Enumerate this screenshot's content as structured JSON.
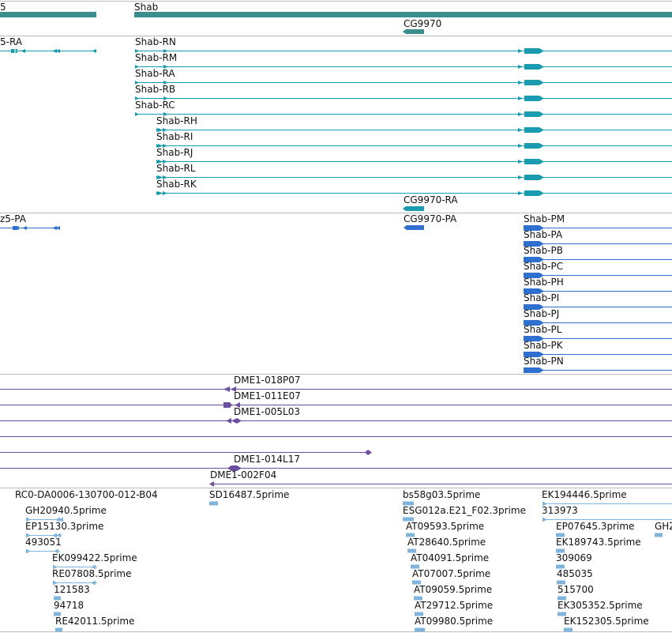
{
  "colors": {
    "gene": "#3c8d8d",
    "transcript": "#1a9cb0",
    "protein": "#2f6fd0",
    "clone": "#6a4fa0",
    "est": "#7fb5dc",
    "separator": "#bbbbbb"
  },
  "tracks": {
    "genes": {
      "items": [
        {
          "label": "5",
          "name": "gene-fragment-left"
        },
        {
          "label": "Shab",
          "name": "gene-shab"
        },
        {
          "label": "CG9970",
          "name": "gene-cg9970"
        }
      ]
    },
    "transcripts": {
      "left_label": "5-RA",
      "cg9970_label": "CG9970-RA",
      "shab_labels": [
        "Shab-RN",
        "Shab-RM",
        "Shab-RA",
        "Shab-RB",
        "Shab-RC",
        "Shab-RH",
        "Shab-RI",
        "Shab-RJ",
        "Shab-RL",
        "Shab-RK"
      ]
    },
    "proteins": {
      "left_label": "z5-PA",
      "cg9970_label": "CG9970-PA",
      "shab_labels": [
        "Shab-PM",
        "Shab-PA",
        "Shab-PB",
        "Shab-PC",
        "Shab-PH",
        "Shab-PI",
        "Shab-PJ",
        "Shab-PL",
        "Shab-PK",
        "Shab-PN"
      ]
    },
    "clones": {
      "labels": [
        "DME1-018P07",
        "DME1-011E07",
        "DME1-005L03",
        "DME1-014L17",
        "DME1-002F04"
      ]
    },
    "ests": {
      "col1": [
        "RC0-DA0006-130700-012-B04",
        "GH20940.5prime",
        "EP15130.3prime",
        "493051",
        "EK099422.5prime",
        "RE07808.5prime",
        "121583",
        "94718",
        "RE42011.5prime"
      ],
      "col2": [
        "SD16487.5prime"
      ],
      "col3": [
        "bs58g03.5prime",
        "ESG012a.E21_F02.3prime",
        "AT09593.5prime",
        "AT28640.5prime",
        "AT04091.5prime",
        "AT07007.5prime",
        "AT09059.5prime",
        "AT29712.5prime",
        "AT09980.5prime"
      ],
      "col4": [
        "EK194446.5prime",
        "313973",
        "EP07645.3prime",
        "EK189743.5prime",
        "309069",
        "485035",
        "515700",
        "EK305352.5prime",
        "EK152305.5prime"
      ],
      "col5": [
        "GHZ"
      ]
    }
  }
}
